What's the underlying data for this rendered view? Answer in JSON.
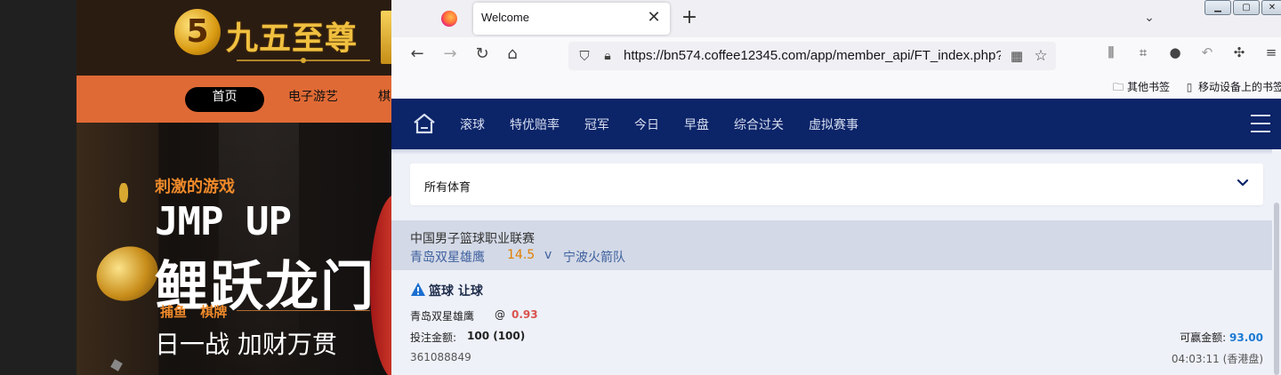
{
  "background_site": {
    "logo_text": "九五至尊",
    "nav": {
      "home": "首页",
      "games": "电子游艺",
      "chess": "棋"
    },
    "banner": {
      "sub": "刺激的游戏",
      "jump": "JMP UP",
      "dragon": "鲤跃龙门",
      "cats": "捕鱼 棋牌",
      "fight": "日一战 加财万贯"
    }
  },
  "browser": {
    "tab_title": "Welcome",
    "tab_close": "✕",
    "new_tab": "+",
    "url": "https://bn574.coffee12345.com/app/member_api/FT_index.php?",
    "bookmarks": {
      "other": "其他书签",
      "mobile": "移动设备上的书签"
    }
  },
  "app": {
    "nav": {
      "inplay": "滚球",
      "special": "特优赔率",
      "champion": "冠军",
      "today": "今日",
      "early": "早盘",
      "parlay": "综合过关",
      "virtual": "虚拟赛事"
    },
    "sport_filter": {
      "selected": "所有体育"
    },
    "match": {
      "league": "中国男子篮球职业联赛",
      "home_team": "青岛双星雄鹰",
      "handicap": "14.5",
      "versus": "v",
      "away_team": "宁波火箭队"
    },
    "bet": {
      "type": "篮球 让球",
      "selection": "青岛双星雄鹰",
      "at": "@",
      "odds": "0.93",
      "stake_label": "投注金额:",
      "stake_value": "100 (100)",
      "win_label": "可赢金额:",
      "win_value": "93.00",
      "ticket_id": "361088849",
      "time": "04:03:11 (香港盘)"
    }
  },
  "colors": {
    "nav_bg": "#0c2468",
    "handicap": "#e07f00",
    "odds": "#d9534f",
    "win_value": "#1a7ad4",
    "team_link": "#3d5f9e"
  }
}
